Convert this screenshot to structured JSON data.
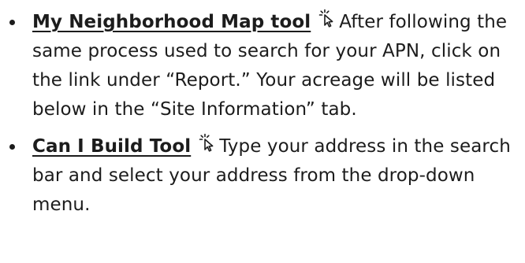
{
  "items": [
    {
      "link_label": "My Neighborhood Map tool",
      "icon": "click-cursor-icon",
      "description": "After following the same process used to search for your APN, click on the link under “Report.” Your acreage will be listed below in the “Site Information” tab."
    },
    {
      "link_label": "Can I Build Tool",
      "icon": "click-cursor-icon",
      "description": "Type your address in the search bar and select your address from the drop-down menu."
    }
  ],
  "colors": {
    "text": "#1c1c1c",
    "background": "#ffffff"
  }
}
